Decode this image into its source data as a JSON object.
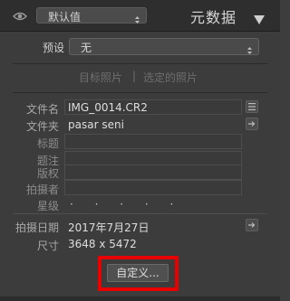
{
  "header": {
    "preset_value": "默认值",
    "panel_title": "元数据",
    "collapse_glyph": "▼"
  },
  "preset_row": {
    "label": "预设",
    "value": "无"
  },
  "tabs": {
    "target_photo": "目标照片",
    "separator": "|",
    "selected_photos": "选定的照片"
  },
  "fields": {
    "filename_label": "文件名",
    "filename_value": "IMG_0014.CR2",
    "folder_label": "文件夹",
    "folder_value": "pasar seni",
    "title_label": "标题",
    "caption_label": "题注",
    "copyright_label": "版权",
    "creator_label": "拍摄者",
    "rating_label": "星级",
    "rating_value": "· · · · ·",
    "capture_date_label": "拍摄日期",
    "capture_date_value": "2017年7月27日",
    "dimensions_label": "尺寸",
    "dimensions_value": "3648 x 5472"
  },
  "customize_button_label": "自定义...",
  "colors": {
    "panel_bg": "#3c3c3c",
    "header_bg": "#2e2e2e",
    "highlight": "#e80000"
  },
  "icons": [
    "eye-icon",
    "updown-arrows-icon",
    "collapse-triangle-icon",
    "list-icon",
    "go-arrow-icon"
  ]
}
